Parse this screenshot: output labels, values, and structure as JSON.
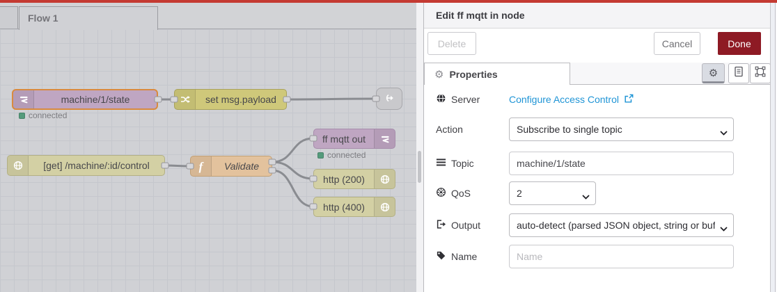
{
  "colors": {
    "topbar_red": "#c43a32",
    "done_button_red": "#8e1a24",
    "link_blue": "#2095d6",
    "status_green": "#559b7c",
    "selected_node_border_orange": "#d98a3e"
  },
  "workspace": {
    "tab": {
      "label": "Flow 1"
    },
    "nodes": {
      "mqtt_in": {
        "label": "machine/1/state",
        "status": "connected"
      },
      "change": {
        "label": "set msg.payload"
      },
      "http_in": {
        "label": "[get] /machine/:id/control"
      },
      "function": {
        "label": "Validate"
      },
      "mqtt_out": {
        "label": "ff mqtt out",
        "status": "connected"
      },
      "http_res_200": {
        "label": "http (200)"
      },
      "http_res_400": {
        "label": "http (400)"
      }
    }
  },
  "panel": {
    "title": "Edit ff mqtt in node",
    "delete_label": "Delete",
    "cancel_label": "Cancel",
    "done_label": "Done",
    "tab_label": "Properties",
    "icons": {
      "gear": "⚙"
    },
    "fields": {
      "server": {
        "label": "Server",
        "link_text": "Configure Access Control"
      },
      "action": {
        "label": "Action",
        "value": "Subscribe to single topic"
      },
      "topic": {
        "label": "Topic",
        "value": "machine/1/state"
      },
      "qos": {
        "label": "QoS",
        "value": "2"
      },
      "output": {
        "label": "Output",
        "value": "auto-detect (parsed JSON object, string or buffer)"
      },
      "name": {
        "label": "Name",
        "placeholder": "Name"
      }
    }
  }
}
